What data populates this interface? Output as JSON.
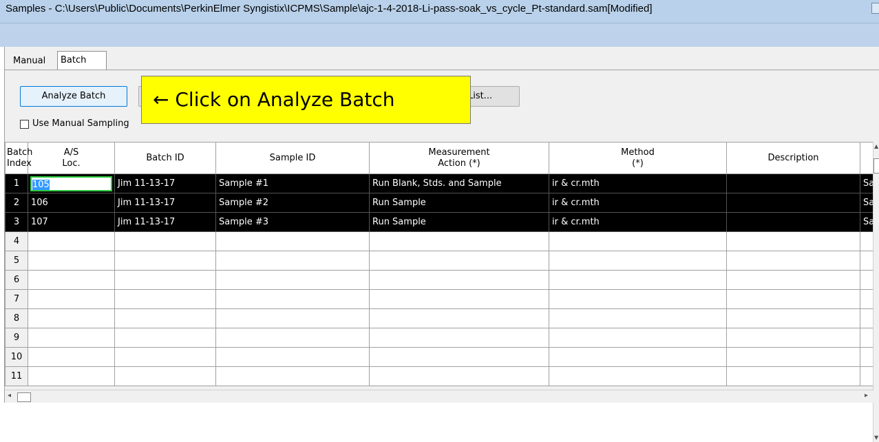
{
  "window": {
    "title": "Samples - C:\\Users\\Public\\Documents\\PerkinElmer Syngistix\\ICPMS\\Sample\\ajc-1-4-2018-Li-pass-soak_vs_cycle_Pt-standard.sam[Modified]"
  },
  "tabs": [
    {
      "label": "Manual"
    },
    {
      "label": "Batch"
    }
  ],
  "toolbar": {
    "analyze_batch_label": "Analyze Batch",
    "list_button_label": "List...",
    "manual_sampling_label": "Use Manual Sampling",
    "manual_sampling_checked": false
  },
  "callout": {
    "text": "← Click on Analyze Batch",
    "color": "#ffff00"
  },
  "grid": {
    "columns": [
      {
        "line1": "Batch",
        "line2": "Index"
      },
      {
        "line1": "A/S",
        "line2": "Loc."
      },
      {
        "line1": "Batch ID",
        "line2": ""
      },
      {
        "line1": "Sample ID",
        "line2": ""
      },
      {
        "line1": "Measurement",
        "line2": "Action (*)"
      },
      {
        "line1": "Method",
        "line2": "(*)"
      },
      {
        "line1": "Description",
        "line2": ""
      },
      {
        "line1": "",
        "line2": ""
      }
    ],
    "rows": [
      {
        "index": "1",
        "loc": "105",
        "batch_id": "Jim 11-13-17",
        "sample_id": "Sample #1",
        "action": "Run Blank, Stds. and Sample",
        "method": "ir & cr.mth",
        "description": "",
        "extra": "Sa"
      },
      {
        "index": "2",
        "loc": "106",
        "batch_id": "Jim 11-13-17",
        "sample_id": "Sample #2",
        "action": "Run Sample",
        "method": "ir & cr.mth",
        "description": "",
        "extra": "Sa"
      },
      {
        "index": "3",
        "loc": "107",
        "batch_id": "Jim 11-13-17",
        "sample_id": "Sample #3",
        "action": "Run Sample",
        "method": "ir & cr.mth",
        "description": "",
        "extra": "Sa"
      },
      {
        "index": "4",
        "loc": "",
        "batch_id": "",
        "sample_id": "",
        "action": "",
        "method": "",
        "description": "",
        "extra": ""
      },
      {
        "index": "5",
        "loc": "",
        "batch_id": "",
        "sample_id": "",
        "action": "",
        "method": "",
        "description": "",
        "extra": ""
      },
      {
        "index": "6",
        "loc": "",
        "batch_id": "",
        "sample_id": "",
        "action": "",
        "method": "",
        "description": "",
        "extra": ""
      },
      {
        "index": "7",
        "loc": "",
        "batch_id": "",
        "sample_id": "",
        "action": "",
        "method": "",
        "description": "",
        "extra": ""
      },
      {
        "index": "8",
        "loc": "",
        "batch_id": "",
        "sample_id": "",
        "action": "",
        "method": "",
        "description": "",
        "extra": ""
      },
      {
        "index": "9",
        "loc": "",
        "batch_id": "",
        "sample_id": "",
        "action": "",
        "method": "",
        "description": "",
        "extra": ""
      },
      {
        "index": "10",
        "loc": "",
        "batch_id": "",
        "sample_id": "",
        "action": "",
        "method": "",
        "description": "",
        "extra": ""
      },
      {
        "index": "11",
        "loc": "",
        "batch_id": "",
        "sample_id": "",
        "action": "",
        "method": "",
        "description": "",
        "extra": ""
      }
    ],
    "selected_row_count": 3
  }
}
